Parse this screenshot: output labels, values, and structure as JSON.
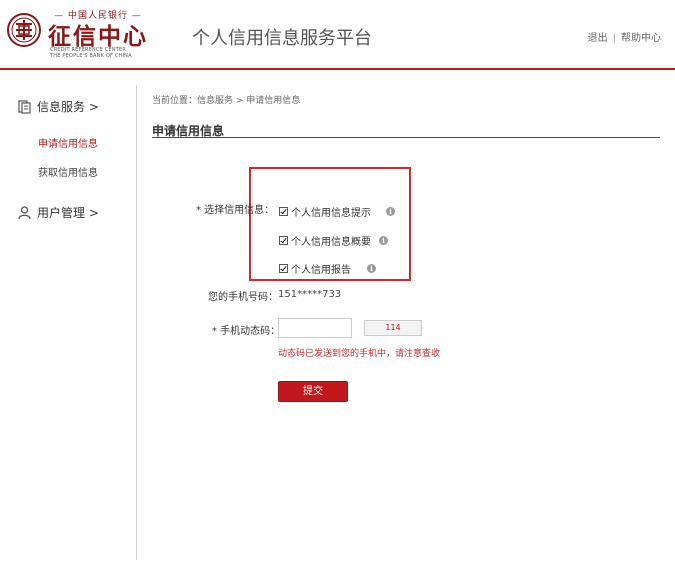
{
  "header": {
    "logo_top": "— 中国人民银行 —",
    "logo_main": "征信中心",
    "logo_en_line1": "CREDIT REFERENCE CENTER",
    "logo_en_line2": "THE PEOPLE'S BANK OF CHINA",
    "platform_title": "个人信用信息服务平台",
    "logout": "退出",
    "separator": "|",
    "help": "帮助中心"
  },
  "sidebar": {
    "info_service": "信息服务 >",
    "apply_credit": "申请信用信息",
    "get_credit": "获取信用信息",
    "user_manage": "用户管理 >"
  },
  "breadcrumb": "当前位置：信息服务 > 申请信用信息",
  "section_title": "申请信用信息",
  "form": {
    "select_label": "* 选择信用信息：",
    "options": [
      {
        "label": "个人信用信息提示",
        "checked": true
      },
      {
        "label": "个人信用信息概要",
        "checked": true
      },
      {
        "label": "个人信用报告",
        "checked": true
      }
    ],
    "phone_label": "您的手机号码：",
    "phone_value": "151*****733",
    "code_label": "* 手机动态码：",
    "code_value": "",
    "code_button": "114",
    "sent_message": "动态码已发送到您的手机中，请注意查收",
    "submit": "提交"
  },
  "colors": {
    "accent": "#b71c1c",
    "highlight": "#d9262a",
    "submit": "#c0181c"
  }
}
